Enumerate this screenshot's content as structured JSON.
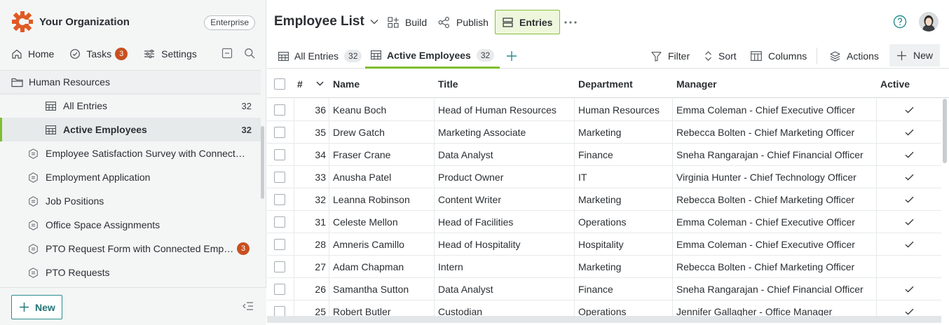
{
  "sidebar": {
    "org_name": "Your Organization",
    "plan_badge": "Enterprise",
    "nav": {
      "home": "Home",
      "tasks": "Tasks",
      "tasks_count": "3",
      "settings": "Settings"
    },
    "section_title": "Human Resources",
    "views": [
      {
        "label": "All Entries",
        "count": "32"
      },
      {
        "label": "Active Employees",
        "count": "32"
      }
    ],
    "apps": [
      {
        "label": "Employee Satisfaction Survey with Connected Employee List",
        "badge": ""
      },
      {
        "label": "Employment Application",
        "badge": ""
      },
      {
        "label": "Job Positions",
        "badge": ""
      },
      {
        "label": "Office Space Assignments",
        "badge": ""
      },
      {
        "label": "PTO Request Form with Connected Employee List",
        "badge": "3"
      },
      {
        "label": "PTO Requests",
        "badge": ""
      }
    ],
    "new_button": "New"
  },
  "header": {
    "form_title": "Employee List",
    "build": "Build",
    "publish": "Publish",
    "entries": "Entries"
  },
  "tabs": [
    {
      "label": "All Entries",
      "count": "32"
    },
    {
      "label": "Active Employees",
      "count": "32"
    }
  ],
  "toolbar": {
    "filter": "Filter",
    "sort": "Sort",
    "columns": "Columns",
    "actions": "Actions",
    "new": "New"
  },
  "table": {
    "columns": {
      "num": "#",
      "name": "Name",
      "title": "Title",
      "department": "Department",
      "manager": "Manager",
      "active": "Active"
    },
    "rows": [
      {
        "num": "36",
        "name": "Keanu Boch",
        "title": "Head of Human Resources",
        "department": "Human Resources",
        "manager": "Emma Coleman - Chief Executive Officer",
        "active": true
      },
      {
        "num": "35",
        "name": "Drew Gatch",
        "title": "Marketing Associate",
        "department": "Marketing",
        "manager": "Rebecca Bolten - Chief Marketing Officer",
        "active": true
      },
      {
        "num": "34",
        "name": "Fraser Crane",
        "title": "Data Analyst",
        "department": "Finance",
        "manager": "Sneha Rangarajan - Chief Financial Officer",
        "active": true
      },
      {
        "num": "33",
        "name": "Anusha Patel",
        "title": "Product Owner",
        "department": "IT",
        "manager": "Virginia Hunter - Chief Technology Officer",
        "active": true
      },
      {
        "num": "32",
        "name": "Leanna Robinson",
        "title": "Content Writer",
        "department": "Marketing",
        "manager": "Rebecca Bolten - Chief Marketing Officer",
        "active": true
      },
      {
        "num": "31",
        "name": "Celeste Mellon",
        "title": "Head of Facilities",
        "department": "Operations",
        "manager": "Emma Coleman - Chief Executive Officer",
        "active": true
      },
      {
        "num": "28",
        "name": "Amneris Camillo",
        "title": "Head of Hospitality",
        "department": "Hospitality",
        "manager": "Emma Coleman - Chief Executive Officer",
        "active": true
      },
      {
        "num": "27",
        "name": "Adam Chapman",
        "title": "Intern",
        "department": "Marketing",
        "manager": "Rebecca Bolten - Chief Marketing Officer",
        "active": false
      },
      {
        "num": "26",
        "name": "Samantha Sutton",
        "title": "Data Analyst",
        "department": "Finance",
        "manager": "Sneha Rangarajan - Chief Financial Officer",
        "active": true
      },
      {
        "num": "25",
        "name": "Robert Butler",
        "title": "Custodian",
        "department": "Operations",
        "manager": "Jennifer Gallagher - Office Manager",
        "active": true
      }
    ]
  },
  "colors": {
    "accent_green": "#7cbf2f",
    "teal": "#2a8c8c",
    "badge_orange": "#c8501f",
    "logo_orange": "#e05a24"
  },
  "icons": [
    "logo-icon",
    "home-icon",
    "tasks-icon",
    "settings-icon",
    "window-icon",
    "search-icon",
    "folder-icon",
    "table-icon",
    "form-icon",
    "plus-icon",
    "collapse-icon",
    "chevron-down-icon",
    "build-icon",
    "publish-icon",
    "entries-icon",
    "more-icon",
    "help-icon",
    "avatar",
    "filter-icon",
    "sort-icon",
    "columns-icon",
    "actions-icon",
    "checkmark-icon"
  ]
}
